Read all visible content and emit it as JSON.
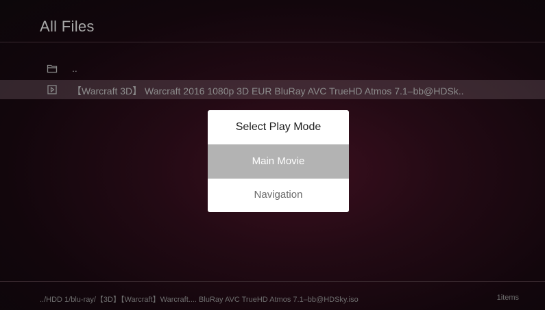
{
  "header": {
    "title": "All Files"
  },
  "list": {
    "parent": {
      "icon": "folder-icon",
      "label": ".."
    },
    "file": {
      "icon": "video-file-icon",
      "label": "【Warcraft 3D】 Warcraft 2016 1080p 3D EUR BluRay AVC TrueHD Atmos 7.1–bb@HDSk.."
    }
  },
  "dialog": {
    "title": "Select Play Mode",
    "options": [
      "Main Movie",
      "Navigation"
    ],
    "selected": "Main Movie"
  },
  "footer": {
    "path": "../HDD 1/blu-ray/【3D】【Warcraft】Warcraft.... BluRay AVC TrueHD Atmos 7.1–bb@HDSky.iso",
    "count": "1items"
  }
}
